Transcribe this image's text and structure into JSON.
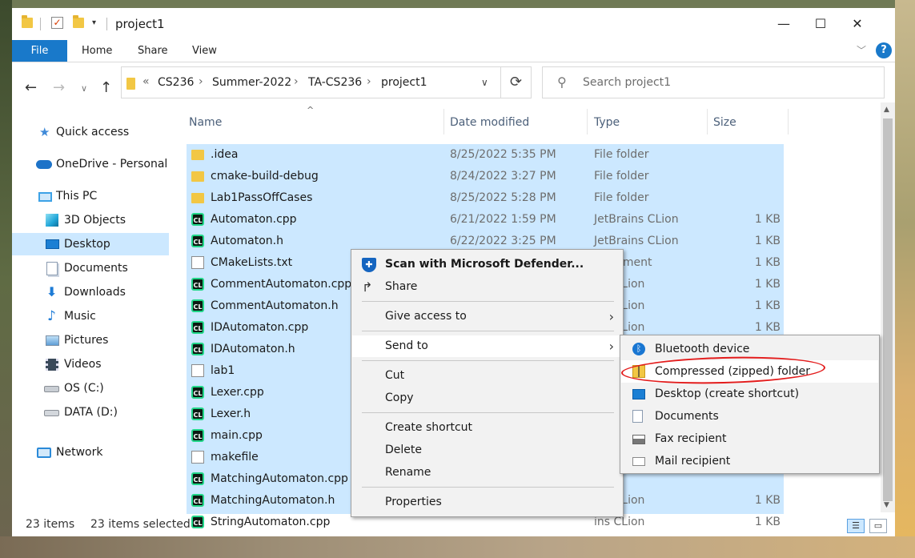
{
  "window": {
    "title": "project1",
    "controls": {
      "minimize": "—",
      "maximize": "☐",
      "close": "✕"
    }
  },
  "ribbon": {
    "tabs": [
      "File",
      "Home",
      "Share",
      "View"
    ],
    "help": "?"
  },
  "address": {
    "overflow": "«",
    "crumbs": [
      "CS236",
      "Summer-2022",
      "TA-CS236",
      "project1"
    ],
    "separator": "›"
  },
  "search": {
    "placeholder": "Search project1"
  },
  "sidebar": {
    "items": [
      {
        "label": "Quick access",
        "icon": "star-icon"
      },
      {
        "label": "OneDrive - Personal",
        "icon": "cloud-icon"
      },
      {
        "label": "This PC",
        "icon": "computer-icon"
      },
      {
        "label": "3D Objects",
        "icon": "cube-icon"
      },
      {
        "label": "Desktop",
        "icon": "desktop-icon",
        "selected": true
      },
      {
        "label": "Documents",
        "icon": "documents-icon"
      },
      {
        "label": "Downloads",
        "icon": "download-icon"
      },
      {
        "label": "Music",
        "icon": "music-note-icon"
      },
      {
        "label": "Pictures",
        "icon": "picture-icon"
      },
      {
        "label": "Videos",
        "icon": "film-icon"
      },
      {
        "label": "OS (C:)",
        "icon": "windows-drive-icon"
      },
      {
        "label": "DATA (D:)",
        "icon": "drive-icon"
      },
      {
        "label": "Network",
        "icon": "network-icon"
      }
    ]
  },
  "columns": [
    "Name",
    "Date modified",
    "Type",
    "Size"
  ],
  "files": [
    {
      "name": ".idea",
      "date": "8/25/2022 5:35 PM",
      "type": "File folder",
      "size": "",
      "icon": "folder"
    },
    {
      "name": "cmake-build-debug",
      "date": "8/24/2022 3:27 PM",
      "type": "File folder",
      "size": "",
      "icon": "folder"
    },
    {
      "name": "Lab1PassOffCases",
      "date": "8/25/2022 5:28 PM",
      "type": "File folder",
      "size": "",
      "icon": "folder"
    },
    {
      "name": "Automaton.cpp",
      "date": "6/21/2022 1:59 PM",
      "type": "JetBrains CLion",
      "size": "1 KB",
      "icon": "clion"
    },
    {
      "name": "Automaton.h",
      "date": "6/22/2022 3:25 PM",
      "type": "JetBrains CLion",
      "size": "1 KB",
      "icon": "clion"
    },
    {
      "name": "CMakeLists.txt",
      "date": "",
      "type": "Document",
      "size": "1 KB",
      "icon": "file"
    },
    {
      "name": "CommentAutomaton.cpp",
      "date": "",
      "type": "ins CLion",
      "size": "1 KB",
      "icon": "clion"
    },
    {
      "name": "CommentAutomaton.h",
      "date": "",
      "type": "ins CLion",
      "size": "1 KB",
      "icon": "clion"
    },
    {
      "name": "IDAutomaton.cpp",
      "date": "",
      "type": "ins CLion",
      "size": "1 KB",
      "icon": "clion"
    },
    {
      "name": "IDAutomaton.h",
      "date": "",
      "type": "",
      "size": "",
      "icon": "clion"
    },
    {
      "name": "lab1",
      "date": "",
      "type": "",
      "size": "",
      "icon": "file"
    },
    {
      "name": "Lexer.cpp",
      "date": "",
      "type": "",
      "size": "",
      "icon": "clion"
    },
    {
      "name": "Lexer.h",
      "date": "",
      "type": "",
      "size": "",
      "icon": "clion"
    },
    {
      "name": "main.cpp",
      "date": "",
      "type": "",
      "size": "",
      "icon": "clion"
    },
    {
      "name": "makefile",
      "date": "",
      "type": "",
      "size": "",
      "icon": "file"
    },
    {
      "name": "MatchingAutomaton.cpp",
      "date": "",
      "type": "",
      "size": "",
      "icon": "clion"
    },
    {
      "name": "MatchingAutomaton.h",
      "date": "",
      "type": "ins CLion",
      "size": "1 KB",
      "icon": "clion"
    },
    {
      "name": "StringAutomaton.cpp",
      "date": "",
      "type": "ins CLion",
      "size": "1 KB",
      "icon": "clion"
    }
  ],
  "status": {
    "items": "23 items",
    "selected": "23 items selected"
  },
  "context_menu": {
    "items": [
      {
        "label": "Scan with Microsoft Defender...",
        "icon": "defender-shield-icon",
        "bold": true
      },
      {
        "label": "Share",
        "icon": "share-icon"
      },
      {
        "label": "Give access to",
        "submenu": true
      },
      {
        "label": "Send to",
        "submenu": true,
        "hover": true
      },
      {
        "label": "Cut"
      },
      {
        "label": "Copy"
      },
      {
        "label": "Create shortcut"
      },
      {
        "label": "Delete"
      },
      {
        "label": "Rename"
      },
      {
        "label": "Properties"
      }
    ]
  },
  "send_to_menu": {
    "items": [
      {
        "label": "Bluetooth device",
        "icon": "bluetooth-icon"
      },
      {
        "label": "Compressed (zipped) folder",
        "icon": "zip-folder-icon",
        "hover": true,
        "annotated": true
      },
      {
        "label": "Desktop (create shortcut)",
        "icon": "desktop-icon"
      },
      {
        "label": "Documents",
        "icon": "documents-icon"
      },
      {
        "label": "Fax recipient",
        "icon": "fax-icon"
      },
      {
        "label": "Mail recipient",
        "icon": "mail-icon"
      }
    ]
  },
  "colors": {
    "accent": "#1979ca",
    "selection": "#cce8ff",
    "annotation": "#e31b1b"
  }
}
